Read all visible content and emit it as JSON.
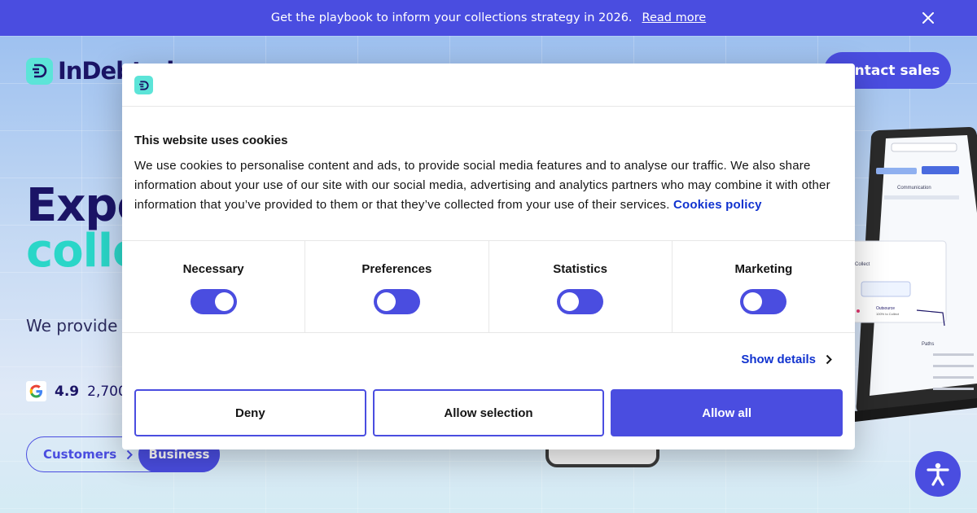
{
  "announcement": {
    "text": "Get the playbook to inform your collections strategy in 2026.",
    "link": "Read more"
  },
  "header": {
    "logo": "InDebted",
    "contact_label": "Contact sales"
  },
  "hero": {
    "headline_line1": "Expe",
    "headline_line2": "colle",
    "subtitle": "We provide fu support cons",
    "rating_score": "4.9",
    "rating_count": "2,700+",
    "segment_customers": "Customers",
    "segment_business": "Business"
  },
  "cookie_modal": {
    "title": "This website uses cookies",
    "body": "We use cookies to personalise content and ads, to provide social media features and to analyse our traffic. We also share information about your use of our site with our social media, advertising and analytics partners who may combine it with other information that you’ve provided to them or that they’ve collected from your use of their services.",
    "policy_link": "Cookies policy",
    "categories": [
      {
        "label": "Necessary",
        "enabled": true
      },
      {
        "label": "Preferences",
        "enabled": false
      },
      {
        "label": "Statistics",
        "enabled": false
      },
      {
        "label": "Marketing",
        "enabled": false
      }
    ],
    "show_details": "Show details",
    "buttons": {
      "deny": "Deny",
      "allow_selection": "Allow selection",
      "allow_all": "Allow all"
    }
  },
  "illustration": {
    "labels": [
      "Communication",
      "Collect",
      "Outsource",
      "100% to Collect",
      "Paths"
    ]
  },
  "colors": {
    "accent": "#4a4de0",
    "teal": "#2ad6c8",
    "navy": "#1b1466",
    "link": "#1032cf"
  }
}
